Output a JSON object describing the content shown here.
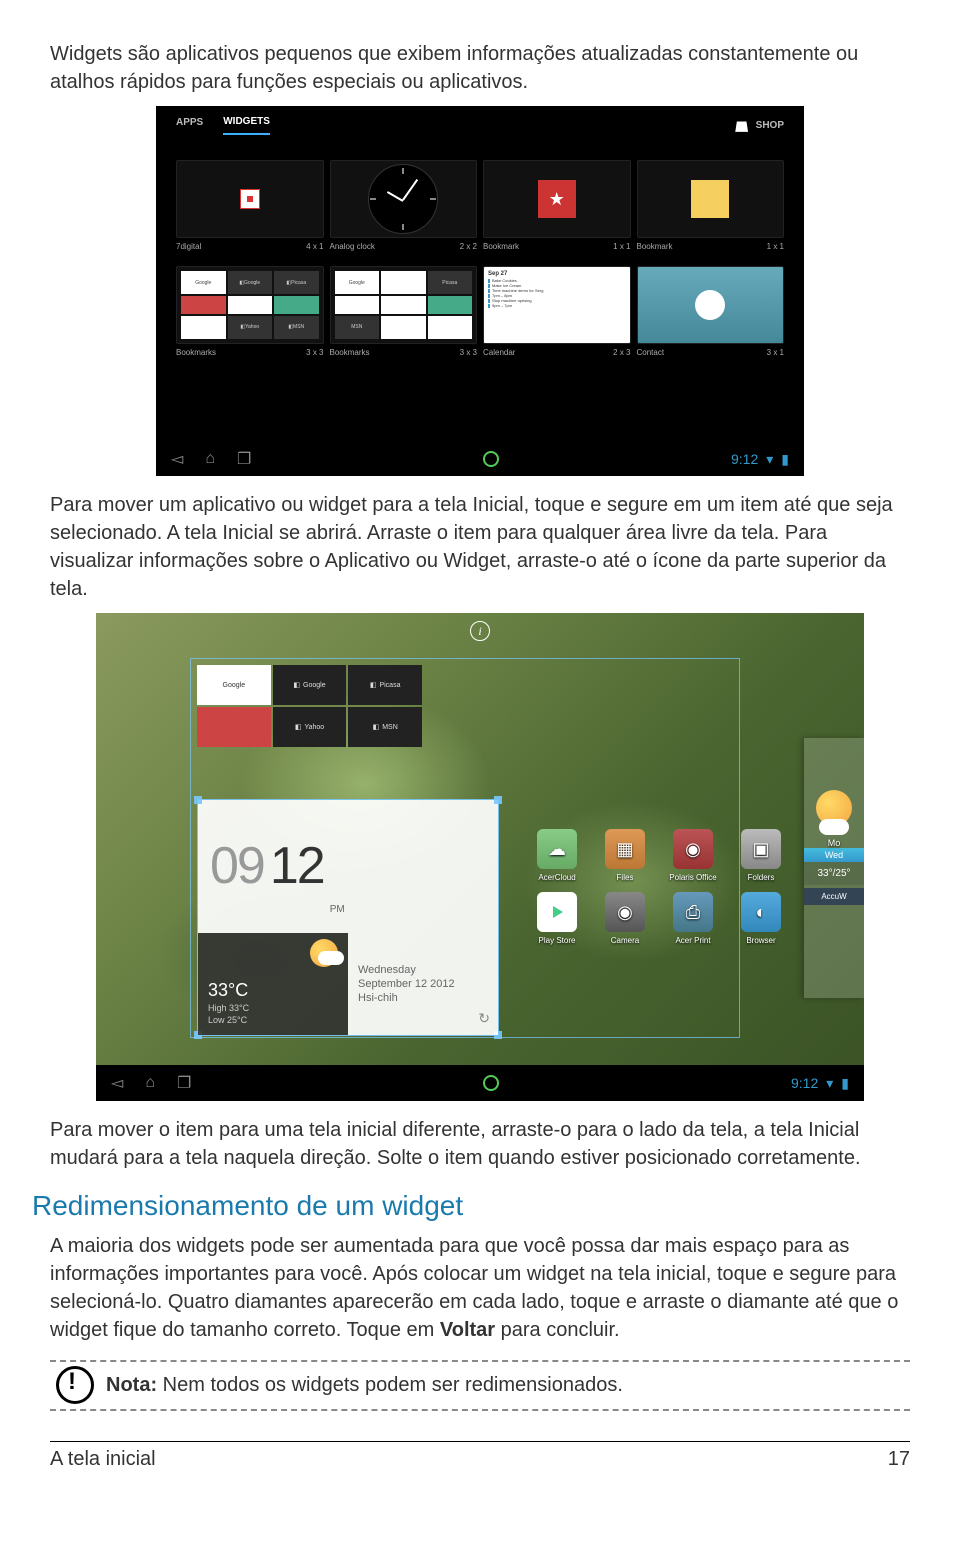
{
  "intro_text": "Widgets são aplicativos pequenos que exibem informações atualizadas constantemente ou atalhos rápidos para funções especiais ou aplicativos.",
  "screenshot1": {
    "tabs": {
      "apps": "APPS",
      "widgets": "WIDGETS"
    },
    "shop": "SHOP",
    "widgets": [
      {
        "name": "7digital",
        "size": "4 x 1"
      },
      {
        "name": "Analog clock",
        "size": "2 x 2"
      },
      {
        "name": "Bookmark",
        "size": "1 x 1"
      },
      {
        "name": "Bookmark",
        "size": "1 x 1"
      },
      {
        "name": "Bookmarks",
        "size": "3 x 3"
      },
      {
        "name": "Bookmarks",
        "size": "3 x 3"
      },
      {
        "name": "Calendar",
        "size": "2 x 3"
      },
      {
        "name": "Contact",
        "size": "3 x 1"
      }
    ],
    "calendar_preview": {
      "date": "Sep 27"
    },
    "bookmark_tiles": {
      "google": "Google",
      "picasa": "Picasa",
      "yahoo": "Yahoo",
      "msn": "MSN"
    },
    "statusbar": {
      "time": "9:12"
    }
  },
  "paragraph2": "Para mover um aplicativo ou widget para a tela Inicial, toque e segure em um item até que seja selecionado. A tela Inicial se abrirá. Arraste o item para qualquer área livre da tela. Para visualizar informações sobre o Aplicativo ou Widget, arraste-o até o ícone da parte superior da tela.",
  "screenshot2": {
    "bookmark_tiles": {
      "google": "Google",
      "picasa": "Picasa",
      "yahoo": "Yahoo",
      "msn": "MSN"
    },
    "clock": {
      "hour": "09",
      "minute": "12",
      "ampm": "PM"
    },
    "weather": {
      "temp": "33°C",
      "high": "High   33°C",
      "low": "Low    25°C"
    },
    "date": {
      "day": "Wednesday",
      "full": "September 12 2012",
      "loc": "Hsi-chih"
    },
    "apps": [
      "AcerCloud",
      "Files",
      "Polaris Office",
      "Folders",
      "Play Store",
      "Camera",
      "Acer Print",
      "Browser"
    ],
    "side": {
      "mo": "Mo",
      "wed": "Wed",
      "temps": "33°/25°",
      "accu": "AccuW"
    },
    "statusbar": {
      "time": "9:12"
    }
  },
  "paragraph3": "Para mover o item para uma tela inicial diferente, arraste-o para o lado da tela, a tela Inicial mudará para a tela naquela direção. Solte o item quando estiver posicionado corretamente.",
  "section_heading": "Redimensionamento de um widget",
  "paragraph4_a": "A maioria dos widgets pode ser aumentada para que você possa dar mais espaço para as informações importantes para você. Após colocar um widget na tela inicial, toque e segure para selecioná-lo. Quatro diamantes aparecerão em cada lado, toque e arraste o diamante até que o widget fique do tamanho correto. Toque em ",
  "paragraph4_b": "Voltar",
  "paragraph4_c": " para concluir.",
  "note_label": "Nota:",
  "note_text": " Nem todos os widgets podem ser redimensionados.",
  "footer": {
    "title": "A tela inicial",
    "page": "17"
  }
}
